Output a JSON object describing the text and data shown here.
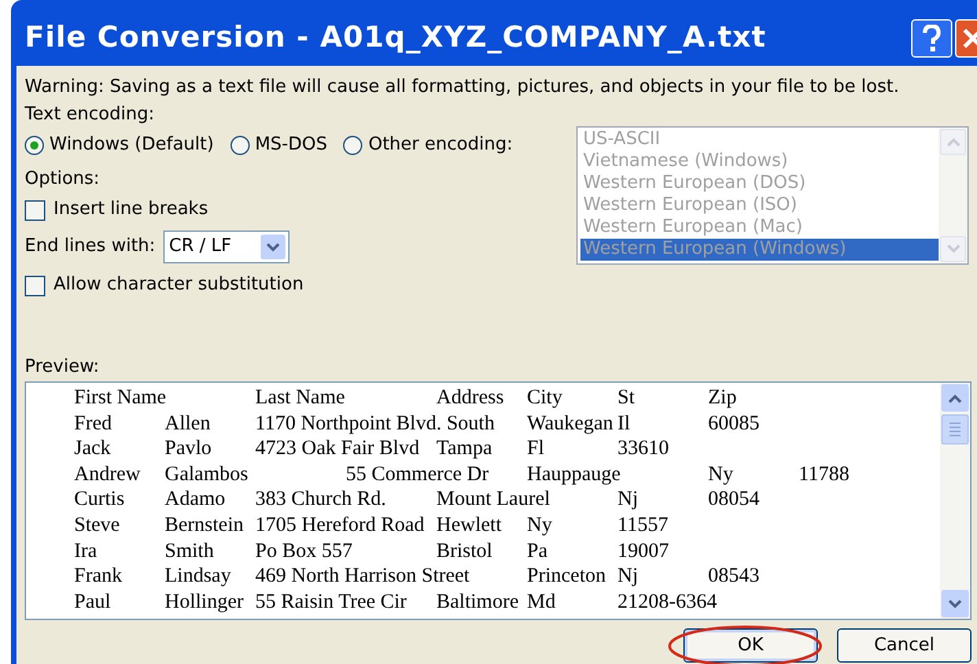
{
  "window": {
    "title": "File Conversion - A01q_XYZ_COMPANY_A.txt"
  },
  "warning": "Warning: Saving as a text file will cause all formatting, pictures, and objects in your file to be lost.",
  "encoding_label": "Text encoding:",
  "encodings": [
    {
      "label": "Windows (Default)",
      "selected": true
    },
    {
      "label": "MS-DOS",
      "selected": false
    },
    {
      "label": "Other encoding:",
      "selected": false
    }
  ],
  "encoding_list": {
    "disabled": true,
    "items": [
      {
        "label": "US-ASCII",
        "selected": false
      },
      {
        "label": "Vietnamese (Windows)",
        "selected": false
      },
      {
        "label": "Western European (DOS)",
        "selected": false
      },
      {
        "label": "Western European (ISO)",
        "selected": false
      },
      {
        "label": "Western European (Mac)",
        "selected": false
      },
      {
        "label": "Western European (Windows)",
        "selected": true
      }
    ]
  },
  "options_label": "Options:",
  "insert_line_breaks": {
    "label": "Insert line breaks",
    "checked": false
  },
  "end_lines": {
    "label": "End lines with:",
    "value": "CR / LF"
  },
  "allow_substitution": {
    "label": "Allow character substitution",
    "checked": false
  },
  "preview_label": "Preview:",
  "preview_lines": [
    "First Name\tLast Name\tAddress\tCity\tSt\tZip",
    "Fred\tAllen\t1170 Northpoint Blvd. South\tWaukegan\tIl\t60085",
    "Jack\tPavlo\t4723 Oak Fair Blvd\tTampa\tFl\t33610",
    "Andrew\tGalambos\t\t55 Commerce Dr\tHauppauge\tNy\t11788",
    "Curtis\tAdamo\t383 Church Rd.\tMount Laurel\tNj\t08054",
    "Steve\tBernstein\t1705 Hereford Road\tHewlett\tNy\t11557",
    "Ira\tSmith\tPo Box 557\tBristol\tPa\t19007",
    "Frank\tLindsay\t469 North Harrison Street\tPrinceton\tNj\t08543",
    "Paul\tHollinger\t55 Raisin Tree Cir\tBaltimore\tMd\t21208-6364"
  ],
  "buttons": [
    {
      "label": "OK",
      "highlighted": true
    },
    {
      "label": "Cancel",
      "highlighted": false
    }
  ]
}
